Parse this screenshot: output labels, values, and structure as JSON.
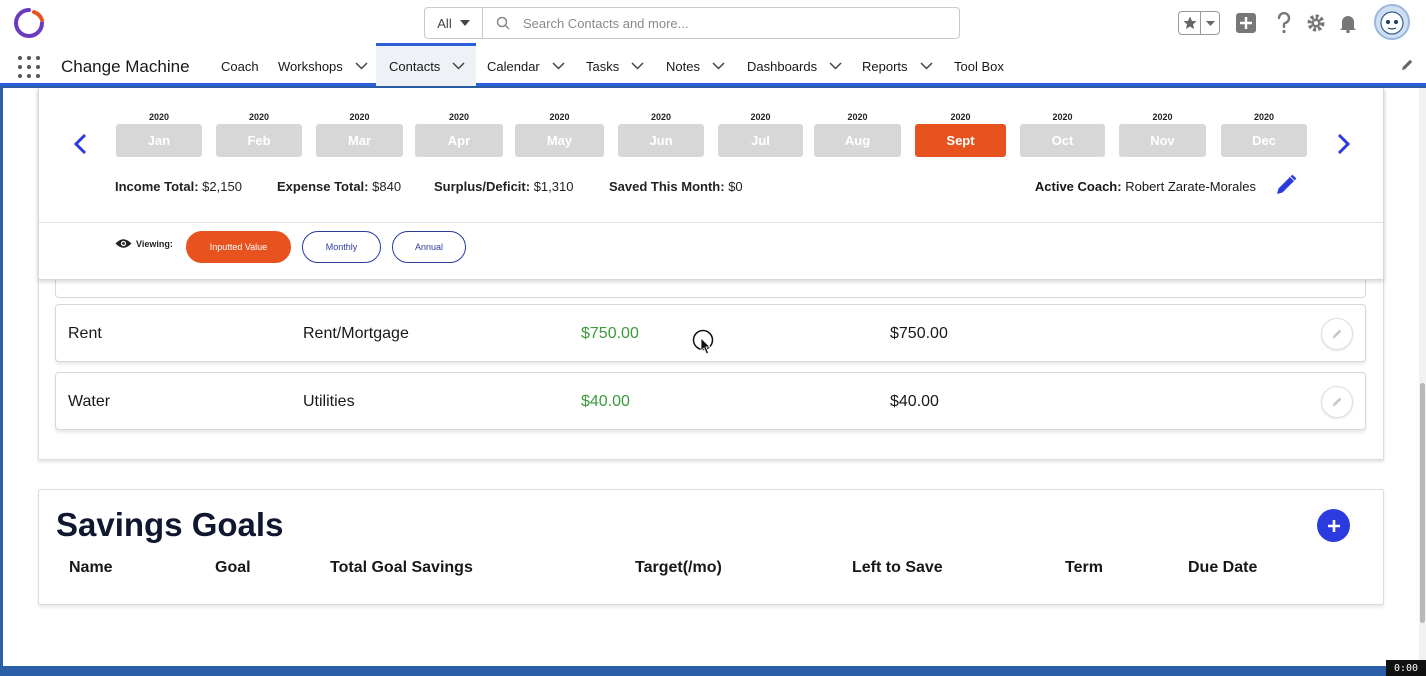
{
  "header": {
    "search_scope": "All",
    "search_placeholder": "Search Contacts and more..."
  },
  "nav": {
    "app_name": "Change Machine",
    "items": [
      {
        "label": "Coach",
        "has_menu": false
      },
      {
        "label": "Workshops",
        "has_menu": true
      },
      {
        "label": "Contacts",
        "has_menu": true,
        "active": true
      },
      {
        "label": "Calendar",
        "has_menu": true
      },
      {
        "label": "Tasks",
        "has_menu": true
      },
      {
        "label": "Notes",
        "has_menu": true
      },
      {
        "label": "Dashboards",
        "has_menu": true
      },
      {
        "label": "Reports",
        "has_menu": true
      },
      {
        "label": "Tool Box",
        "has_menu": false
      }
    ]
  },
  "months": [
    {
      "year": "2020",
      "label": "Jan"
    },
    {
      "year": "2020",
      "label": "Feb"
    },
    {
      "year": "2020",
      "label": "Mar"
    },
    {
      "year": "2020",
      "label": "Apr"
    },
    {
      "year": "2020",
      "label": "May"
    },
    {
      "year": "2020",
      "label": "Jun"
    },
    {
      "year": "2020",
      "label": "Jul"
    },
    {
      "year": "2020",
      "label": "Aug"
    },
    {
      "year": "2020",
      "label": "Sept",
      "selected": true
    },
    {
      "year": "2020",
      "label": "Oct"
    },
    {
      "year": "2020",
      "label": "Nov"
    },
    {
      "year": "2020",
      "label": "Dec"
    }
  ],
  "totals": {
    "income_label": "Income Total:",
    "income_value": "$2,150",
    "expense_label": "Expense Total:",
    "expense_value": "$840",
    "surplus_label": "Surplus/Deficit:",
    "surplus_value": "$1,310",
    "saved_label": "Saved This Month:",
    "saved_value": "$0",
    "coach_label": "Active Coach:",
    "coach_value": "Robert Zarate-Morales"
  },
  "viewing": {
    "label": "Viewing:",
    "options": [
      "Inputted Value",
      "Monthly",
      "Annual"
    ],
    "active": "Inputted Value"
  },
  "expenses": [
    {
      "name": "Rent",
      "category": "Rent/Mortgage",
      "amount": "$750.00",
      "monthly": "$750.00"
    },
    {
      "name": "Water",
      "category": "Utilities",
      "amount": "$40.00",
      "monthly": "$40.00"
    }
  ],
  "savings": {
    "title": "Savings Goals",
    "columns": [
      "Name",
      "Goal",
      "Total Goal Savings",
      "Target(/mo)",
      "Left to Save",
      "Term",
      "Due Date"
    ]
  },
  "recording_timer": "0:00",
  "colors": {
    "accent_orange": "#e8521f",
    "brand_blue": "#2b3be0",
    "amount_green": "#3a9a3a",
    "month_inactive": "#d7d7d7"
  }
}
